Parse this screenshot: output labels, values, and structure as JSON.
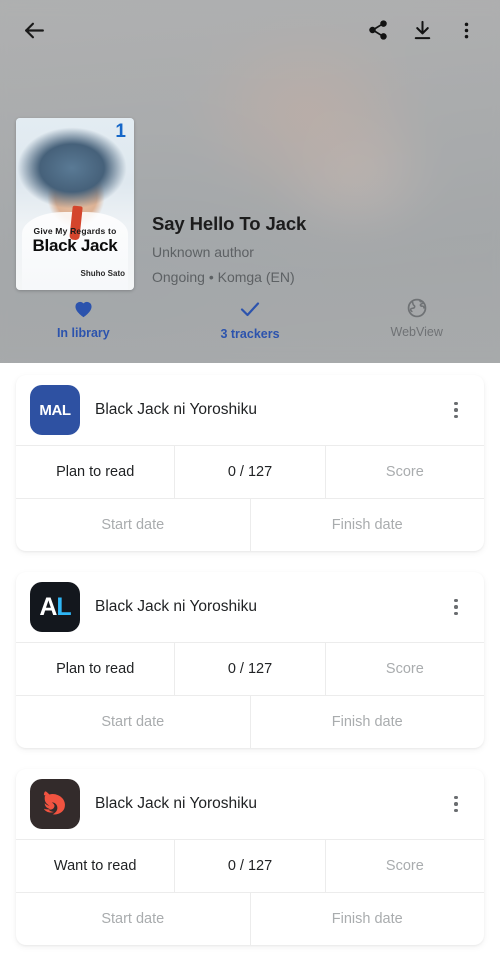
{
  "appbar": {
    "back_icon": "arrow-left-icon",
    "share_icon": "share-icon",
    "download_icon": "download-icon",
    "overflow_icon": "more-vertical-icon"
  },
  "manga": {
    "title": "Say Hello To Jack",
    "author": "Unknown author",
    "status_source": "Ongoing • Komga (EN)",
    "cover": {
      "volume_number": "1",
      "line1": "Give My Regards to",
      "line2": "Black Jack",
      "line3": "Shuho Sato"
    }
  },
  "actions": [
    {
      "label": "In library",
      "icon": "heart-filled-icon",
      "state": "active"
    },
    {
      "label": "3 trackers",
      "icon": "check-icon",
      "state": "active"
    },
    {
      "label": "WebView",
      "icon": "globe-icon",
      "state": "inactive"
    }
  ],
  "trackers": [
    {
      "service": "MyAnimeList",
      "logo": "mal-logo-icon",
      "logo_text": "MAL",
      "entry_title": "Black Jack ni Yoroshiku",
      "menu_icon": "more-vertical-icon",
      "status": "Plan to read",
      "progress": "0 / 127",
      "score": "Score",
      "start_date": "Start date",
      "finish_date": "Finish date"
    },
    {
      "service": "AniList",
      "logo": "anilist-logo-icon",
      "logo_text_a": "A",
      "logo_text_l": "L",
      "entry_title": "Black Jack ni Yoroshiku",
      "menu_icon": "more-vertical-icon",
      "status": "Plan to read",
      "progress": "0 / 127",
      "score": "Score",
      "start_date": "Start date",
      "finish_date": "Finish date"
    },
    {
      "service": "Kitsu",
      "logo": "kitsu-fox-logo-icon",
      "entry_title": "Black Jack ni Yoroshiku",
      "menu_icon": "more-vertical-icon",
      "status": "Want to read",
      "progress": "0 / 127",
      "score": "Score",
      "start_date": "Start date",
      "finish_date": "Finish date"
    }
  ],
  "colors": {
    "accent_blue": "#2c53ad",
    "mal_blue": "#2e51a2",
    "anilist_dark": "#13171d",
    "anilist_blue": "#2fb7f6",
    "kitsu_dark": "#332b2b",
    "kitsu_orange": "#f05340",
    "scrim_gray": "#acacac",
    "muted_text": "#a9acae"
  }
}
